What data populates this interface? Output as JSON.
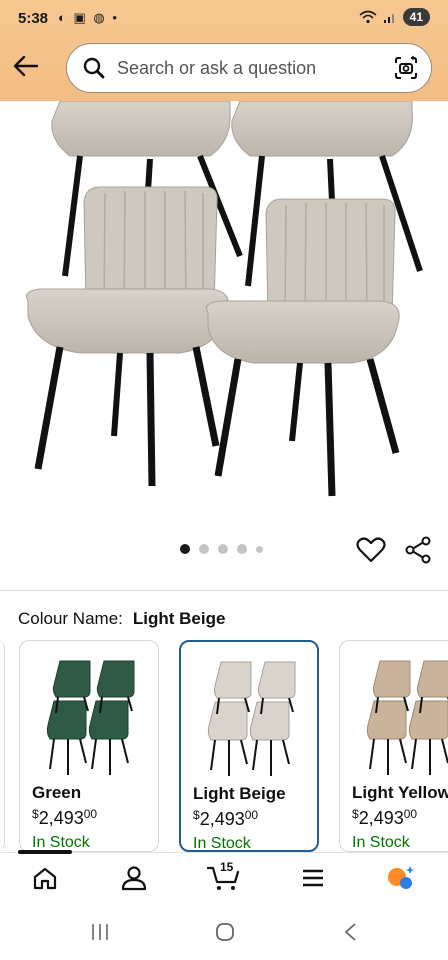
{
  "status_bar": {
    "time": "5:38",
    "notification_icons": "◐ ▣ ◍ •",
    "battery": "41"
  },
  "header": {
    "search_placeholder": "Search or ask a question"
  },
  "gallery": {
    "image_count": 5,
    "active_index": 0
  },
  "colour": {
    "label": "Colour Name:",
    "value": "Light Beige"
  },
  "variants": [
    {
      "name": "Green",
      "currency": "$",
      "whole": "2,493",
      "fraction": "00",
      "stock": "In Stock",
      "selected": false,
      "color": "#2f5a45"
    },
    {
      "name": "Light Beige",
      "currency": "$",
      "whole": "2,493",
      "fraction": "00",
      "stock": "In Stock",
      "selected": true,
      "color": "#d9d3cb"
    },
    {
      "name": "Light Yellow",
      "currency": "$",
      "whole": "2,493",
      "fraction": "00",
      "stock": "In Stock",
      "selected": false,
      "color": "#c9b39a"
    }
  ],
  "bottom_nav": {
    "cart_count": "15",
    "items": [
      "home-icon",
      "account-icon",
      "cart-icon",
      "menu-icon",
      "assistant-icon"
    ]
  },
  "colors": {
    "header_bg": "#f3bd84",
    "selected_border": "#1f5e8f",
    "in_stock": "#007600"
  }
}
